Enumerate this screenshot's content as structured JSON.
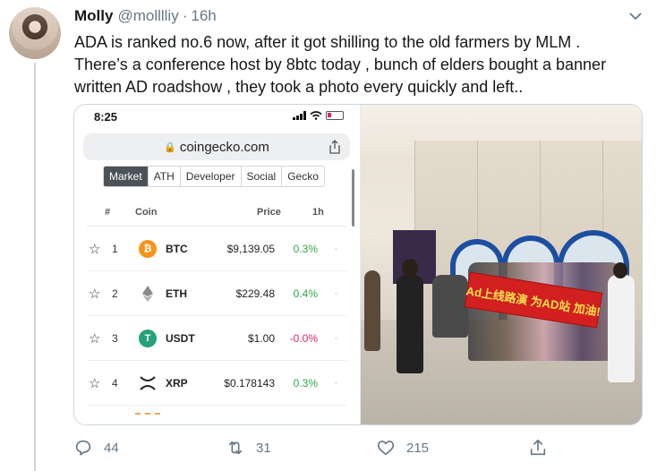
{
  "tweet": {
    "name": "Molly",
    "handle": "@molllliy",
    "separator": "·",
    "time": "16h",
    "text_lines": [
      "ADA is ranked no.6 now, after it got shilling to the old farmers by MLM .",
      "There’s a conference host by 8btc today , bunch of elders bought a banner",
      "written AD roadshow , they took a photo every quickly and left.."
    ]
  },
  "phone": {
    "status_time": "8:25",
    "url": "coingecko.com",
    "tabs": [
      {
        "label": "Market",
        "active": true
      },
      {
        "label": "ATH",
        "active": false
      },
      {
        "label": "Developer",
        "active": false
      },
      {
        "label": "Social",
        "active": false
      },
      {
        "label": "Gecko",
        "active": false
      }
    ],
    "columns": {
      "rank": "#",
      "coin": "Coin",
      "price": "Price",
      "change": "1h"
    },
    "rows": [
      {
        "rank": "1",
        "symbol": "BTC",
        "price": "$9,139.05",
        "change": "0.3%",
        "icon": "bitcoin-icon",
        "color": "#f7931a"
      },
      {
        "rank": "2",
        "symbol": "ETH",
        "price": "$229.48",
        "change": "0.4%",
        "icon": "ethereum-icon",
        "color": "#627eea"
      },
      {
        "rank": "3",
        "symbol": "USDT",
        "price": "$1.00",
        "change": "-0.0%",
        "icon": "tether-icon",
        "color": "#26a17b"
      },
      {
        "rank": "4",
        "symbol": "XRP",
        "price": "$0.178143",
        "change": "0.3%",
        "icon": "xrp-icon",
        "color": "#222222"
      }
    ]
  },
  "photo": {
    "banner_text": "Ad上线路演 为AD站 加油!"
  },
  "actions": {
    "replies": "44",
    "retweets": "31",
    "likes": "215"
  },
  "colors": {
    "text_primary": "#14171a",
    "text_secondary": "#657786",
    "up": "#2ba84a",
    "down": "#e0245e"
  }
}
